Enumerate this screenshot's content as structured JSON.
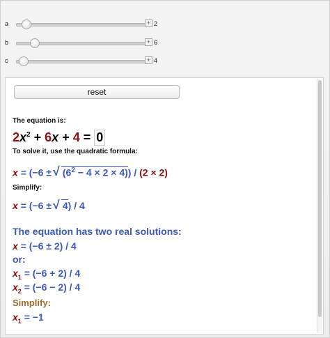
{
  "sliders": [
    {
      "label": "a",
      "value": "2",
      "fraction": 0.1
    },
    {
      "label": "b",
      "value": "6",
      "fraction": 0.15
    },
    {
      "label": "c",
      "value": "4",
      "fraction": 0.08
    }
  ],
  "reset_label": "reset",
  "text": {
    "equation_is": "The equation is:",
    "to_solve": "To solve it, use the quadratic formula:",
    "simplify1": "Simplify:",
    "two_real": "The equation has two real solutions:",
    "or": "or:",
    "simplify2": "Simplify:"
  },
  "equation": {
    "a_coef": "2",
    "x_term": "x",
    "pow": "2",
    "plus1": "+",
    "b_coef": "6",
    "x2": "x",
    "plus2": "+",
    "c_coef": "4",
    "eq": "=",
    "rhs": "0"
  },
  "formula": {
    "lhs": "x",
    "eq": "=",
    "left": "(−6 ±",
    "inside": "(6",
    "inside_sup": "2",
    "inside_rest": "− 4 × 2 × 4)",
    "close": ")",
    "slash": "/",
    "den": "(2 × 2)"
  },
  "simplified": {
    "lhs": "x",
    "eq": "=",
    "left": "(−6 ±",
    "sqrt_arg": "4",
    "close": ") / 4"
  },
  "solutions": {
    "combined_lhs": "x",
    "combined_rest": "= (−6 ± 2) / 4",
    "x1": "x",
    "x1_sub": "1",
    "x1_rest": "= (−6 + 2) / 4",
    "x2": "x",
    "x2_sub": "2",
    "x2_rest": "= (−6 − 2) / 4",
    "final_lhs": "x",
    "final_sub": "1",
    "final_rest": "= −1"
  }
}
